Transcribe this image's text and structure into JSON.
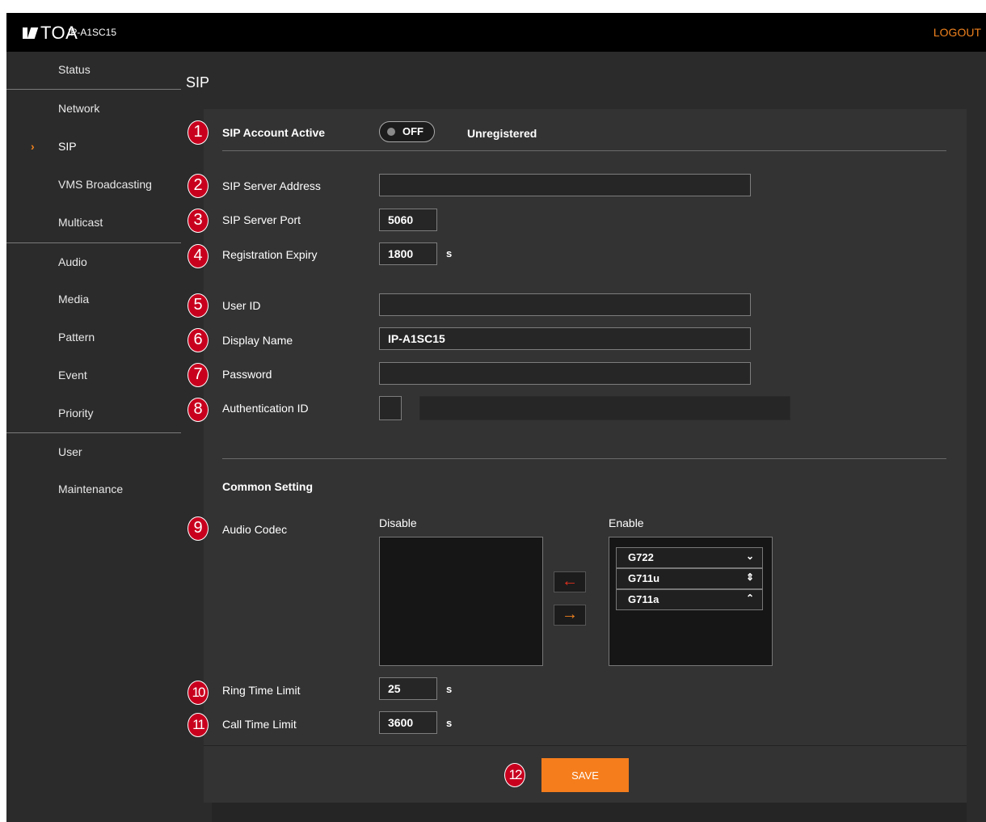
{
  "header": {
    "brand": "TOA",
    "model": "IP-A1SC15",
    "logout_label": "LOGOUT"
  },
  "sidebar": {
    "items": [
      {
        "label": "Status"
      },
      {
        "label": "Network"
      },
      {
        "label": "SIP",
        "active": true
      },
      {
        "label": "VMS Broadcasting"
      },
      {
        "label": "Multicast"
      },
      {
        "label": "Audio"
      },
      {
        "label": "Media"
      },
      {
        "label": "Pattern"
      },
      {
        "label": "Event"
      },
      {
        "label": "Priority"
      },
      {
        "label": "User"
      },
      {
        "label": "Maintenance"
      }
    ]
  },
  "page_title": "SIP",
  "form": {
    "account_active": {
      "badge": "1",
      "label": "SIP Account Active",
      "toggle_state": "OFF",
      "status": "Unregistered"
    },
    "server_address": {
      "badge": "2",
      "label": "SIP Server Address",
      "value": ""
    },
    "server_port": {
      "badge": "3",
      "label": "SIP Server Port",
      "value": "5060"
    },
    "registration_expiry": {
      "badge": "4",
      "label": "Registration Expiry",
      "value": "1800",
      "unit": "s"
    },
    "user_id": {
      "badge": "5",
      "label": "User ID",
      "value": ""
    },
    "display_name": {
      "badge": "6",
      "label": "Display Name",
      "value": "IP-A1SC15"
    },
    "password": {
      "badge": "7",
      "label": "Password",
      "value": ""
    },
    "auth_id": {
      "badge": "8",
      "label": "Authentication ID",
      "value": ""
    }
  },
  "common": {
    "heading": "Common Setting",
    "audio_codec": {
      "badge": "9",
      "label": "Audio Codec",
      "disable_label": "Disable",
      "enable_label": "Enable",
      "disabled": [],
      "enabled": [
        {
          "name": "G722",
          "arrows": "⌄"
        },
        {
          "name": "G711u",
          "arrows": "⇕"
        },
        {
          "name": "G711a",
          "arrows": "⌃"
        }
      ],
      "move_left": "←",
      "move_right": "→"
    },
    "ring_time_limit": {
      "badge": "10",
      "label": "Ring Time Limit",
      "value": "25",
      "unit": "s"
    },
    "call_time_limit": {
      "badge": "11",
      "label": "Call Time Limit",
      "value": "3600",
      "unit": "s"
    }
  },
  "save": {
    "badge": "12",
    "label": "SAVE"
  },
  "colors": {
    "accent": "#f57d1c",
    "badge": "#c8001e",
    "panel": "#333333",
    "background": "#2b2b2b"
  }
}
